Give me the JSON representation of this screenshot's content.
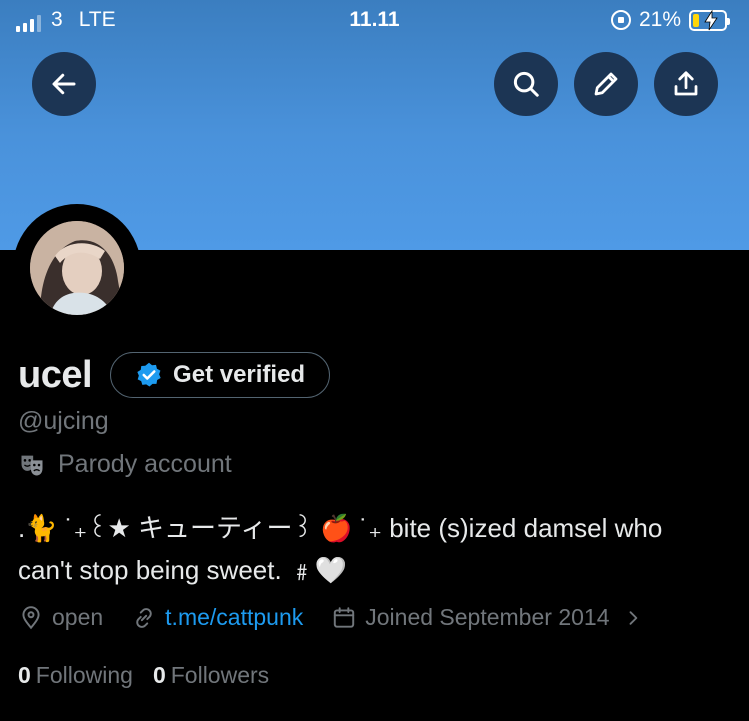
{
  "status_bar": {
    "carrier": "3",
    "network": "LTE",
    "time": "11.11",
    "battery_percent": "21%",
    "battery_level": 0.21
  },
  "header": {
    "banner_color": "#4a92db",
    "buttons": [
      "back-icon",
      "search-icon",
      "pencil-icon",
      "share-icon"
    ]
  },
  "profile": {
    "display_name": "ucel",
    "verify_label": "Get verified",
    "handle": "@ujcing",
    "parody_label": "Parody account",
    "bio_line1": ".🐈 ˙₊꒰★ キューティー꒱ 🍎 ˙₊ bite (s)ized damsel who",
    "bio_line2": "can't stop being sweet. ﹟🤍",
    "location": "open",
    "link": "t.me/cattpunk",
    "joined": "Joined September 2014",
    "following_count": "0",
    "following_label": "Following",
    "followers_count": "0",
    "followers_label": "Followers"
  },
  "colors": {
    "accent": "#1d9bf0",
    "muted": "#71767b",
    "text": "#e7e9ea",
    "background": "#000000"
  }
}
